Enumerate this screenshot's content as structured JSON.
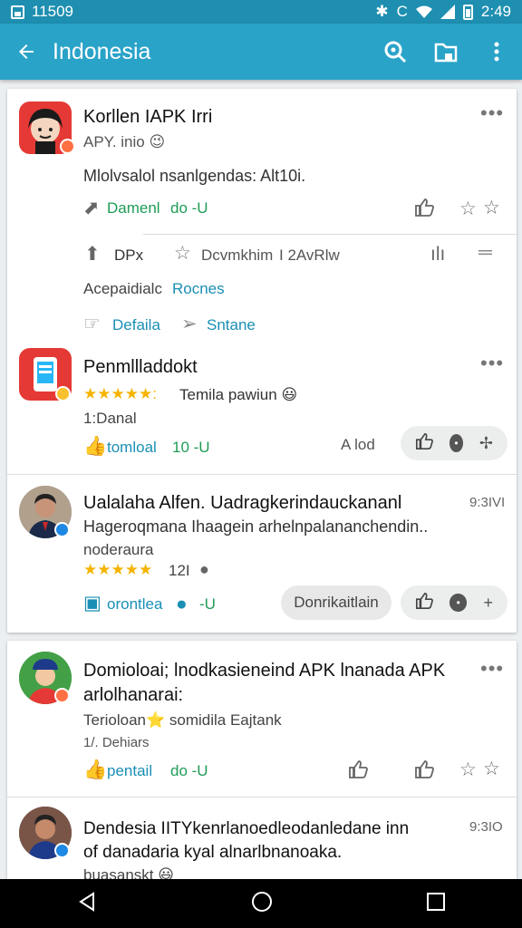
{
  "status_bar": {
    "time_left": "11509",
    "time_right": "2:49",
    "icons": [
      "image-icon",
      "bluetooth-icon",
      "wifi-icon",
      "signal-icon",
      "battery-icon"
    ]
  },
  "app_bar": {
    "title": "Indonesia",
    "actions": [
      "search-icon",
      "folder-icon",
      "more-vert-icon"
    ]
  },
  "feed": [
    {
      "title": "Korllen IAPK Irri",
      "subtitle": "APY. inio 😉",
      "description": "Mlolvsalol nsanlgendas: Alt10i.",
      "download_label": "Damenl",
      "download_count": "do -U",
      "sub_actions": {
        "share_label": "DPx",
        "star_label": "Dcvmkhim",
        "rank_label": "I 2AvRlw"
      },
      "comment_line": "Acepaidialc",
      "comment_link": "Rocnes",
      "details_label": "Defaila",
      "send_label": "Sntane"
    },
    {
      "title": "Penmllladdokt",
      "rating_text": "Temila pawiun 😃",
      "meta": "1:Danal",
      "download_label": "tomloal",
      "download_count": "10 -U",
      "side_label": "A lod"
    },
    {
      "title": "Ualalaha Alfen. Uadragkerindauckananl",
      "time": "9:3IVI",
      "line1": "Hageroqmana Ihaagein arhelnpalananchendin..",
      "line2": "noderaura",
      "rating_count": "12I",
      "download_label": "orontlea",
      "download_count": "-U",
      "pill_label": "Donrikaitlain"
    },
    {
      "title_line1": "Domioloai; lnodkasieneind APK lnanada APK",
      "title_line2": "arlolhanarai:",
      "subtitle": "Terioloan⭐ somidila Eajtank",
      "meta": "1/. Dehiars",
      "download_label": "pentail",
      "download_count": "do -U"
    },
    {
      "title_line1": "Dendesia IITYkenrlanoedleodanledane inn",
      "title_line2": "of danadaria kyal alnarlbnanoaka.",
      "time": "9:3IO",
      "line3": "buasanskt 😃"
    }
  ],
  "colors": {
    "status_bar": "#1e8fb0",
    "app_bar": "#2aa3c8",
    "link": "#1a8fb5",
    "green": "#1f9b57",
    "star": "#f5b400"
  },
  "nav_bar": [
    "back-triangle-icon",
    "home-circle-icon",
    "recents-square-icon"
  ]
}
